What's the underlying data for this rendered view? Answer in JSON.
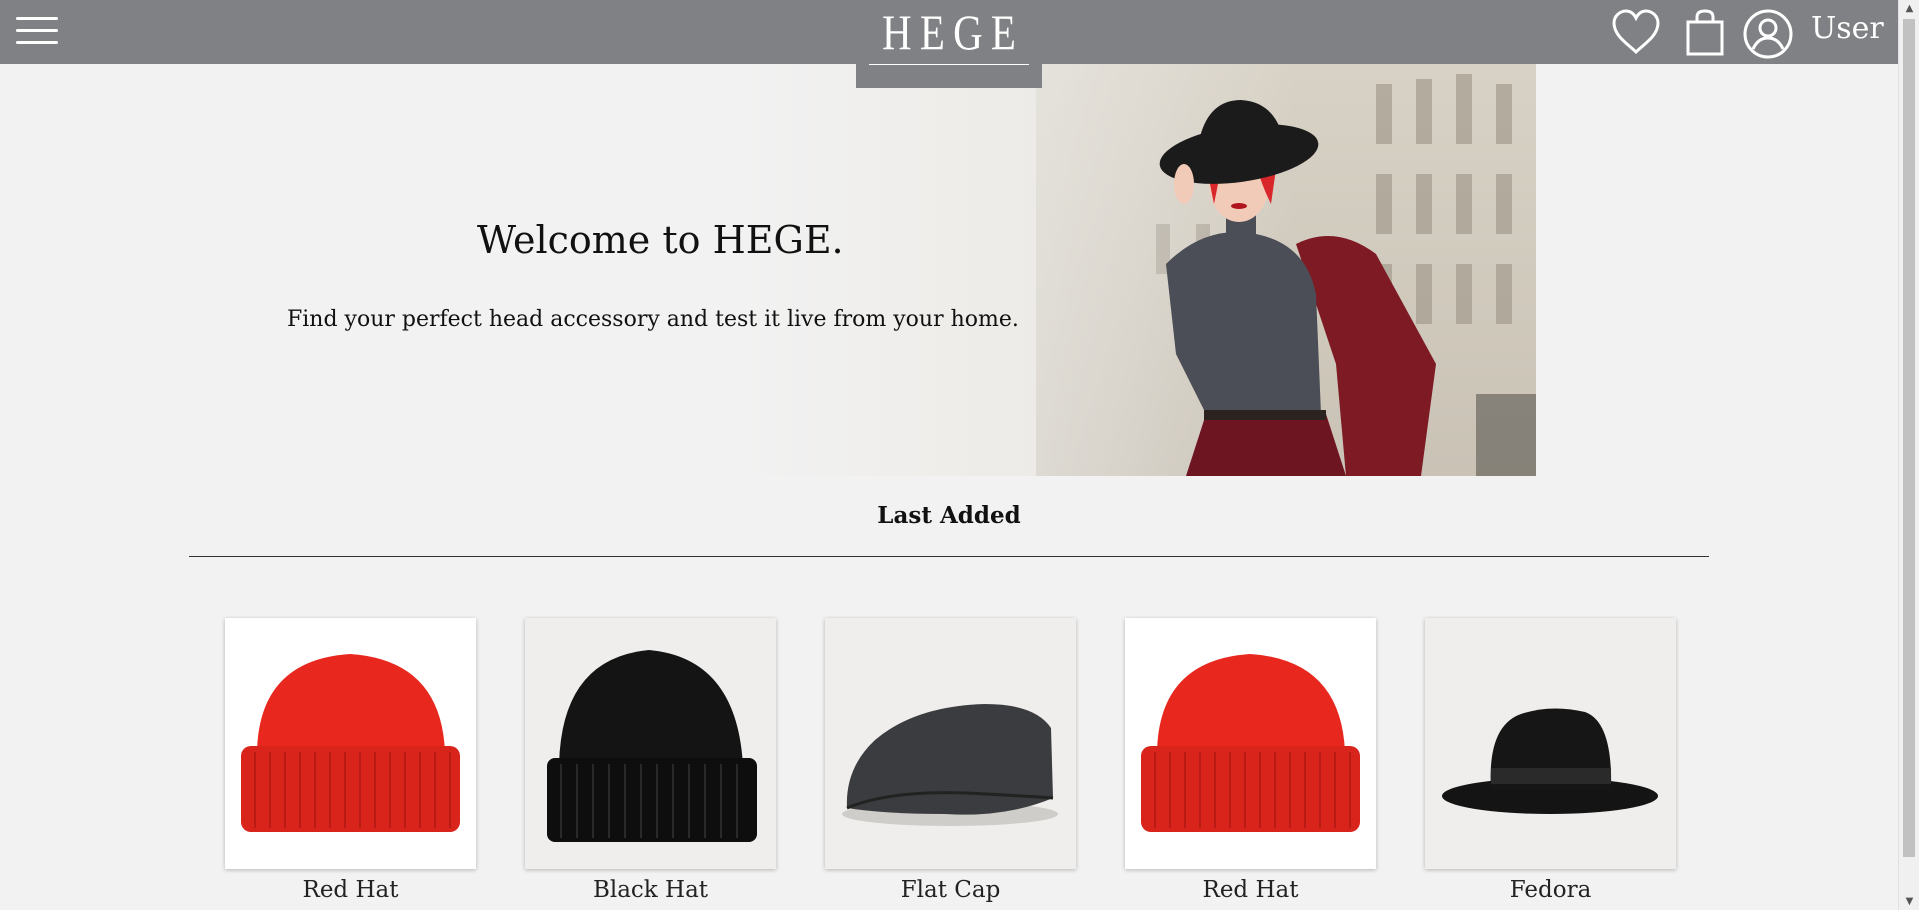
{
  "header": {
    "logo": "HEGE",
    "user_label": "User",
    "icons": [
      "menu-icon",
      "heart-icon",
      "shopping-bag-icon",
      "user-circle-icon"
    ]
  },
  "hero": {
    "title": "Welcome to HEGE.",
    "subtitle": "Find your perfect head accessory and test it live from your home."
  },
  "section": {
    "title": "Last Added"
  },
  "products": [
    {
      "name": "Red Hat",
      "kind": "beanie",
      "color": "#e8281e",
      "bg": "#ffffff"
    },
    {
      "name": "Black Hat",
      "kind": "beanie",
      "color": "#121212",
      "bg": "#efeeec"
    },
    {
      "name": "Flat Cap",
      "kind": "flatcap",
      "color": "#3b3c3f",
      "bg": "#efeeec"
    },
    {
      "name": "Red Hat",
      "kind": "beanie",
      "color": "#e8281e",
      "bg": "#ffffff"
    },
    {
      "name": "Fedora",
      "kind": "fedora",
      "color": "#141414",
      "bg": "#efeeec"
    }
  ],
  "colors": {
    "header_bg": "#808185",
    "page_bg": "#f2f2f2",
    "text": "#111111"
  }
}
